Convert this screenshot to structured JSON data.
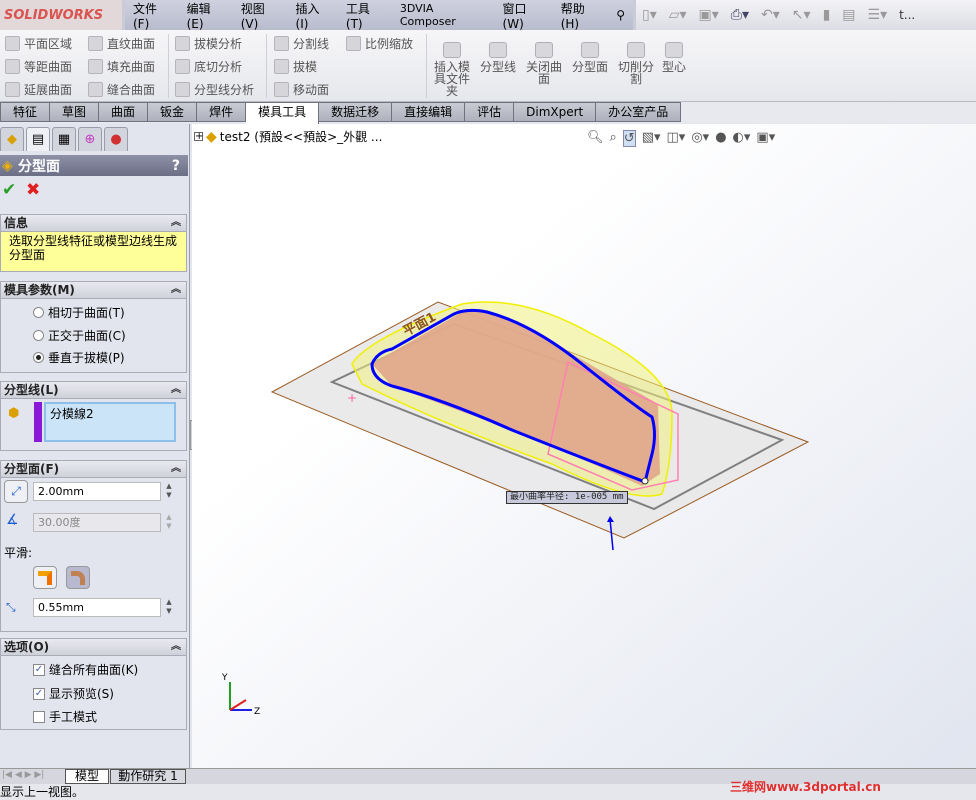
{
  "app": {
    "logo": "SOLIDWORKS",
    "doc_short": "t..."
  },
  "menu": [
    "文件(F)",
    "编辑(E)",
    "视图(V)",
    "插入(I)",
    "工具(T)",
    "3DVIA Composer",
    "窗口(W)",
    "帮助(H)"
  ],
  "quick_toolbar": [
    "new-icon",
    "open-icon",
    "save-icon",
    "print-icon",
    "undo-icon",
    "select-icon",
    "rebuild-icon",
    "options-icon",
    "list-icon"
  ],
  "ribbon": {
    "col1": [
      "平面区域",
      "等距曲面",
      "延展曲面"
    ],
    "col2": [
      "直纹曲面",
      "填充曲面",
      "缝合曲面"
    ],
    "col3": [
      "拔模分析",
      "底切分析",
      "分型线分析"
    ],
    "col4": [
      "分割线",
      "拔模",
      "移动面"
    ],
    "col5": [
      "比例缩放"
    ],
    "big": [
      "插入模具文件夹",
      "分型线",
      "关闭曲面",
      "分型面",
      "切削分割",
      "型心"
    ]
  },
  "tabs": [
    {
      "label": "特征"
    },
    {
      "label": "草图"
    },
    {
      "label": "曲面"
    },
    {
      "label": "钣金"
    },
    {
      "label": "焊件"
    },
    {
      "label": "模具工具",
      "active": true
    },
    {
      "label": "数据迁移"
    },
    {
      "label": "直接编辑"
    },
    {
      "label": "评估"
    },
    {
      "label": "DimXpert"
    },
    {
      "label": "办公室产品"
    }
  ],
  "panel": {
    "title": "分型面",
    "help": "?",
    "info": {
      "header": "信息",
      "text": "选取分型线特征或模型边线生成分型面"
    },
    "mold_params": {
      "header": "模具参数(M)",
      "options": [
        {
          "label": "相切于曲面(T)",
          "selected": false
        },
        {
          "label": "正交于曲面(C)",
          "selected": false
        },
        {
          "label": "垂直于拔模(P)",
          "selected": true
        }
      ]
    },
    "parting_line": {
      "header": "分型线(L)",
      "items": [
        "分模線2"
      ]
    },
    "parting_surface": {
      "header": "分型面(F)",
      "distance": "2.00mm",
      "angle": "30.00度",
      "smooth_label": "平滑:",
      "smooth_distance": "0.55mm"
    },
    "options": {
      "header": "选项(O)",
      "items": [
        {
          "label": "缝合所有曲面(K)",
          "checked": true
        },
        {
          "label": "显示预览(S)",
          "checked": true
        },
        {
          "label": "手工模式",
          "checked": false
        }
      ]
    }
  },
  "viewport": {
    "tree_item": "test2  (預設<<預設>_外觀 ...",
    "plane_label": "平面1",
    "callout": "最小曲率半径: 1e-005 mm",
    "triad": {
      "y": "Y",
      "z": "Z"
    },
    "colors": {
      "parting_line": "#0000ff",
      "surface": "#f0f000",
      "part": "#e8a888"
    }
  },
  "bottom_tabs": [
    "模型",
    "動作研究 1"
  ],
  "status": "显示上一视图。",
  "watermark": "三维网www.3dportal.cn"
}
